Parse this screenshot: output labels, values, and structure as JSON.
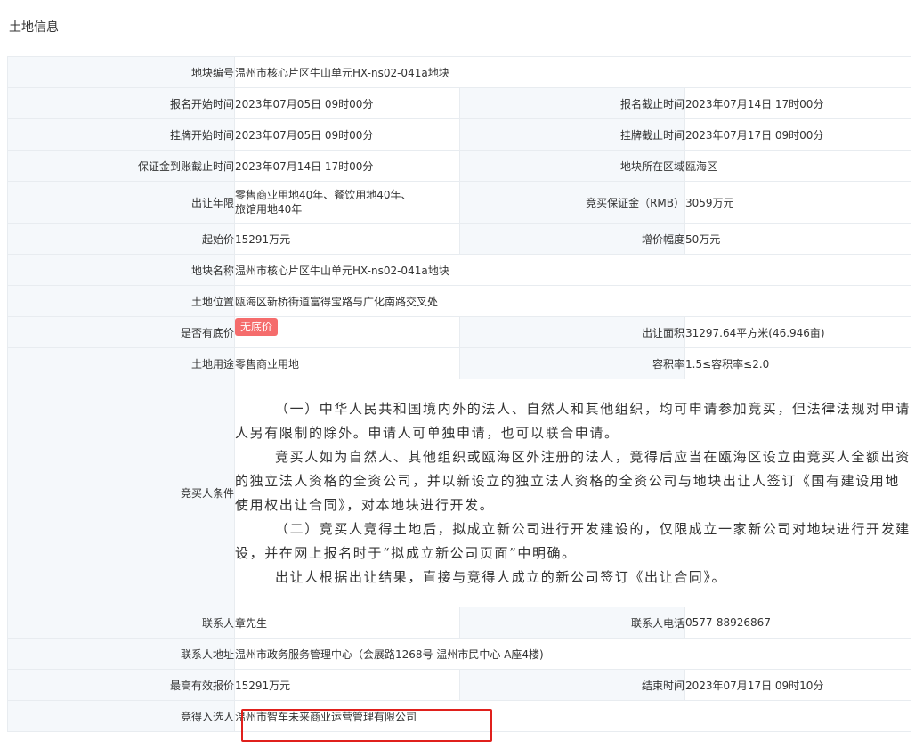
{
  "section_title": "土地信息",
  "rows": {
    "parcel_no": {
      "label": "地块编号",
      "value": "温州市核心片区牛山单元HX-ns02-041a地块"
    },
    "signup_start": {
      "label": "报名开始时间",
      "value": "2023年07月05日 09时00分"
    },
    "signup_end": {
      "label": "报名截止时间",
      "value": "2023年07月14日 17时00分"
    },
    "listing_start": {
      "label": "挂牌开始时间",
      "value": "2023年07月05日 09时00分"
    },
    "listing_end": {
      "label": "挂牌截止时间",
      "value": "2023年07月17日 09时00分"
    },
    "deposit_deadline": {
      "label": "保证金到账截止时间",
      "value": "2023年07月14日 17时00分"
    },
    "district": {
      "label": "地块所在区域",
      "value": "瓯海区"
    },
    "term": {
      "label": "出让年限",
      "value_line1": "零售商业用地40年、餐饮用地40年、",
      "value_line2": "旅馆用地40年"
    },
    "deposit": {
      "label": "竞买保证金（RMB）",
      "value": "3059万元"
    },
    "start_price": {
      "label": "起始价",
      "value": "15291万元"
    },
    "increment": {
      "label": "增价幅度",
      "value": "50万元"
    },
    "parcel_name": {
      "label": "地块名称",
      "value": "温州市核心片区牛山单元HX-ns02-041a地块"
    },
    "location": {
      "label": "土地位置",
      "value": "瓯海区新桥街道富得宝路与广化南路交叉处"
    },
    "reserve_price": {
      "label": "是否有底价",
      "value": "无底价"
    },
    "area": {
      "label": "出让面积",
      "value": "31297.64平方米(46.946亩)"
    },
    "usage": {
      "label": "土地用途",
      "value": "零售商业用地"
    },
    "plot_ratio": {
      "label": "容积率",
      "value": "1.5≤容积率≤2.0"
    },
    "conditions": {
      "label": "竞买人条件",
      "paragraphs": [
        "（一）中华人民共和国境内外的法人、自然人和其他组织，均可申请参加竞买，但法律法规对申请人另有限制的除外。申请人可单独申请，也可以联合申请。",
        "竞买人如为自然人、其他组织或瓯海区外注册的法人，竞得后应当在瓯海区设立由竞买人全额出资的独立法人资格的全资公司，并以新设立的独立法人资格的全资公司与地块出让人签订《国有建设用地使用权出让合同》，对本地块进行开发。",
        "（二）竞买人竞得土地后，拟成立新公司进行开发建设的，仅限成立一家新公司对地块进行开发建设，并在网上报名时于“拟成立新公司页面”中明确。",
        "出让人根据出让结果，直接与竞得人成立的新公司签订《出让合同》。"
      ]
    },
    "contact": {
      "label": "联系人",
      "value": "章先生"
    },
    "phone": {
      "label": "联系人电话",
      "value": "0577-88926867"
    },
    "address": {
      "label": "联系人地址",
      "value": "温州市政务服务管理中心（会展路1268号 温州市民中心 A座4楼)"
    },
    "top_bid": {
      "label": "最高有效报价",
      "value": "15291万元"
    },
    "end_time": {
      "label": "结束时间",
      "value": "2023年07月17日 09时10分"
    },
    "winner": {
      "label": "竞得入选人",
      "value": "温州市智车未来商业运营管理有限公司"
    }
  },
  "colors": {
    "badge": "#f56c6c",
    "highlight": "#e0201c",
    "label_bg": "#f5f8fb",
    "border": "#e8ecf0"
  }
}
